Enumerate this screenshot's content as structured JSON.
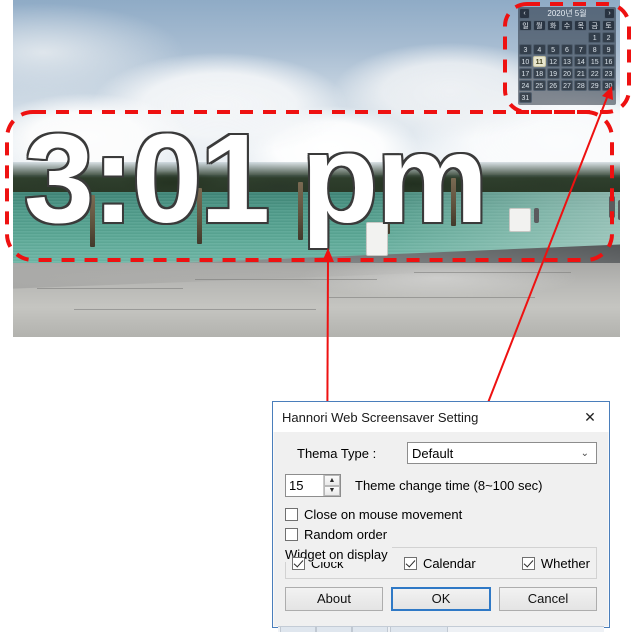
{
  "clock": {
    "time": "3:01 pm"
  },
  "calendar": {
    "prev_label": "‹",
    "next_label": "›",
    "title": "2020년 5월",
    "weekdays": [
      "일",
      "월",
      "화",
      "수",
      "목",
      "금",
      "토"
    ],
    "weeks": [
      [
        "",
        "",
        "",
        "",
        "",
        "1",
        "2"
      ],
      [
        "3",
        "4",
        "5",
        "6",
        "7",
        "8",
        "9"
      ],
      [
        "10",
        "11",
        "12",
        "13",
        "14",
        "15",
        "16"
      ],
      [
        "17",
        "18",
        "19",
        "20",
        "21",
        "22",
        "23"
      ],
      [
        "24",
        "25",
        "26",
        "27",
        "28",
        "29",
        "30"
      ],
      [
        "31",
        "",
        "",
        "",
        "",
        "",
        ""
      ]
    ],
    "today": "11"
  },
  "dialog": {
    "title": "Hannori Web Screensaver Setting",
    "close_label": "✕",
    "thema_type_label": "Thema Type :",
    "thema_type_value": "Default",
    "thema_type_arrow": "⌄",
    "change_time_value": "15",
    "change_time_up": "▲",
    "change_time_down": "▼",
    "change_time_label": "Theme change time (8~100 sec)",
    "checkboxes": [
      {
        "label": "Close on mouse movement",
        "checked": false
      },
      {
        "label": "Random order",
        "checked": false
      }
    ],
    "widget_group_title": "Widget on display",
    "widgets": [
      {
        "label": "Clock",
        "checked": true
      },
      {
        "label": "Calendar",
        "checked": true
      },
      {
        "label": "Whether",
        "checked": true
      }
    ],
    "buttons": [
      {
        "label": "About",
        "default": false
      },
      {
        "label": "OK",
        "default": true
      },
      {
        "label": "Cancel",
        "default": false
      }
    ]
  },
  "annotations": {
    "accent_color": "#ee1111",
    "clock_highlight": "dashed rounded rectangle around clock",
    "calendar_highlight": "dashed rounded rectangle around calendar",
    "arrow_clock": "arrow from Clock checkbox to clock widget",
    "arrow_calendar": "arrow from Calendar checkbox to calendar widget"
  }
}
